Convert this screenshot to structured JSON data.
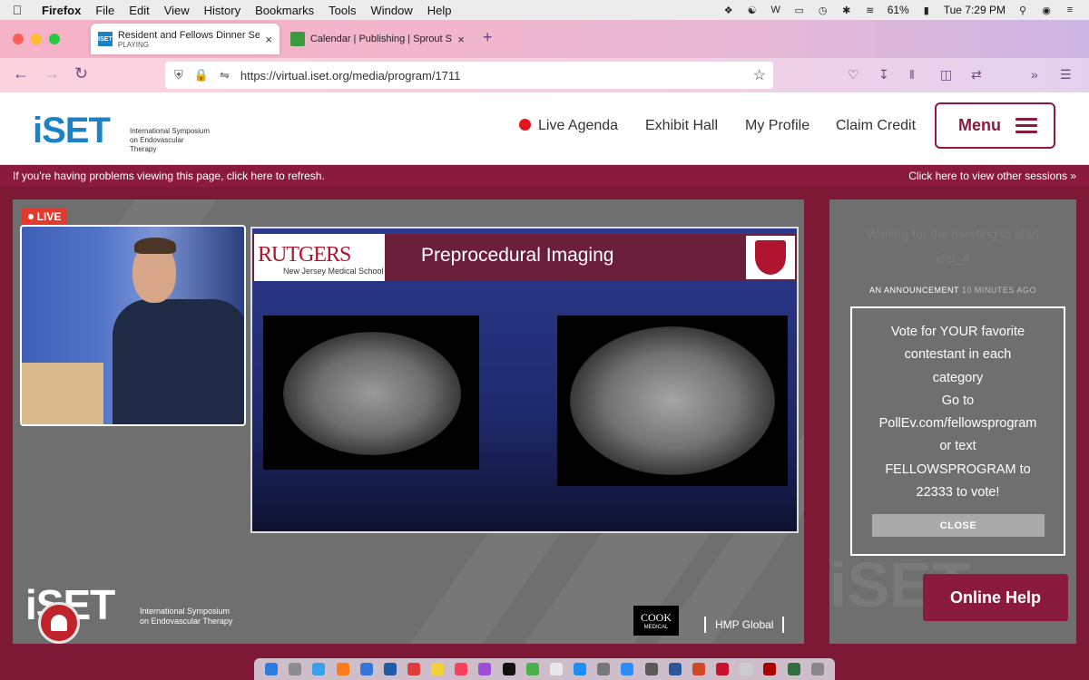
{
  "menubar": {
    "app_name": "Firefox",
    "items": [
      "File",
      "Edit",
      "View",
      "History",
      "Bookmarks",
      "Tools",
      "Window",
      "Help"
    ],
    "battery": "61%",
    "clock": "Tue 7:29 PM"
  },
  "tabs": [
    {
      "title": "Resident and Fellows Dinner Ses",
      "subtitle": "PLAYING",
      "favicon_text": "ISET",
      "favicon_color": "#1b82c5"
    },
    {
      "title": "Calendar | Publishing | Sprout S",
      "favicon_color": "#3a9a3e"
    }
  ],
  "browser": {
    "url": "https://virtual.iset.org/media/program/1711"
  },
  "site": {
    "logo": "iSET",
    "logo_subtitle": "International Symposium on Endovascular Therapy",
    "nav": {
      "live_agenda": "Live Agenda",
      "exhibit_hall": "Exhibit Hall",
      "my_profile": "My Profile",
      "claim_credit": "Claim Credit",
      "menu": "Menu"
    },
    "info_left": "If you're having problems viewing this page, click here to refresh.",
    "info_right": "Click here to view other sessions »"
  },
  "stream": {
    "live_label": "LIVE",
    "slide": {
      "institution": "RUTGERS",
      "school": "New Jersey Medical School",
      "title": "Preprocedural Imaging"
    },
    "footer_logo": "iSET",
    "footer_logo_subtitle": "International Symposium on Endovascular Therapy",
    "sponsor_1": "COOK",
    "sponsor_1_sub": "MEDICAL",
    "sponsor_2": "HMP Global"
  },
  "side": {
    "waiting": "Waiting for the meeting to start",
    "room": "iset_4",
    "announcement_label": "AN ANNOUNCEMENT",
    "announcement_age": "10 MINUTES AGO",
    "announcement_lines": [
      "Vote for YOUR favorite",
      "contestant in each",
      "category",
      "Go to",
      "PollEv.com/fellowsprogram",
      "or text",
      "FELLOWSPROGRAM to",
      "22333 to vote!"
    ],
    "close_label": "CLOSE",
    "help_label": "Online Help"
  },
  "colors": {
    "brand_maroon": "#8a1b3c",
    "brand_blue": "#1b82c5",
    "live_red": "#e23a2e"
  }
}
